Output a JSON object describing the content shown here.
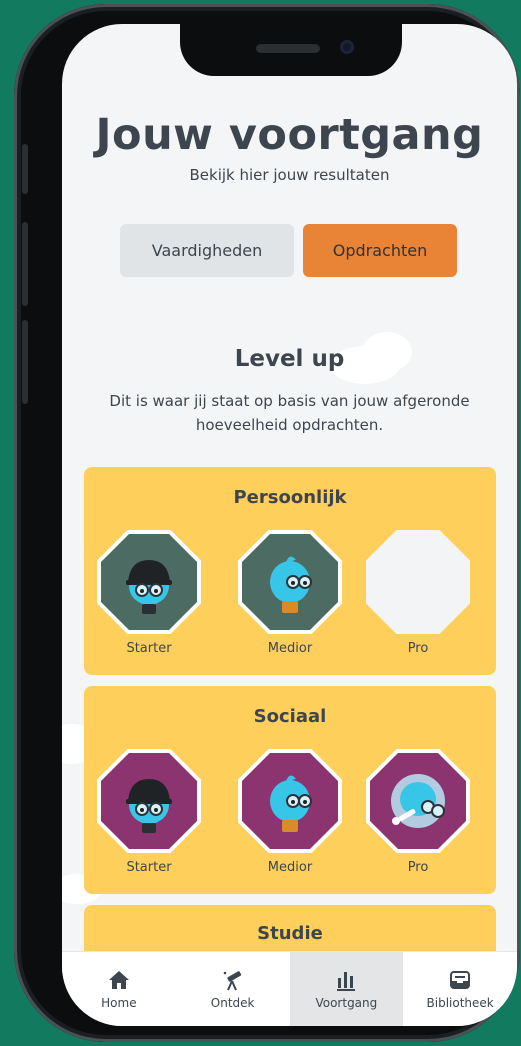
{
  "header": {
    "title": "Jouw voortgang",
    "subtitle": "Bekijk hier jouw resultaten"
  },
  "tabs": [
    {
      "label": "Vaardigheden",
      "active": false
    },
    {
      "label": "Opdrachten",
      "active": true
    }
  ],
  "level_section": {
    "title": "Level up",
    "description": "Dit is waar jij staat op basis van jouw afgeronde hoeveelheid opdrachten."
  },
  "categories": [
    {
      "title": "Persoonlijk",
      "color": "#4c6b62",
      "levels": [
        {
          "label": "Starter",
          "unlocked": true,
          "character": "cap-character-icon"
        },
        {
          "label": "Medior",
          "unlocked": true,
          "character": "tuft-character-icon"
        },
        {
          "label": "Pro",
          "unlocked": false,
          "character": ""
        }
      ]
    },
    {
      "title": "Sociaal",
      "color": "#8b3470",
      "levels": [
        {
          "label": "Starter",
          "unlocked": true,
          "character": "cap-character-icon"
        },
        {
          "label": "Medior",
          "unlocked": true,
          "character": "tuft-character-icon"
        },
        {
          "label": "Pro",
          "unlocked": true,
          "character": "key-bubble-character-icon"
        }
      ]
    },
    {
      "title": "Studie",
      "color": "#fecf5b",
      "levels": []
    }
  ],
  "tabbar": [
    {
      "label": "Home",
      "icon": "home-icon",
      "active": false
    },
    {
      "label": "Ontdek",
      "icon": "telescope-icon",
      "active": false
    },
    {
      "label": "Voortgang",
      "icon": "bar-chart-icon",
      "active": true
    },
    {
      "label": "Bibliotheek",
      "icon": "inbox-icon",
      "active": false
    }
  ],
  "colors": {
    "accent": "#e98436",
    "card": "#fecf5b",
    "text": "#3d464e",
    "background": "#127a5f"
  }
}
